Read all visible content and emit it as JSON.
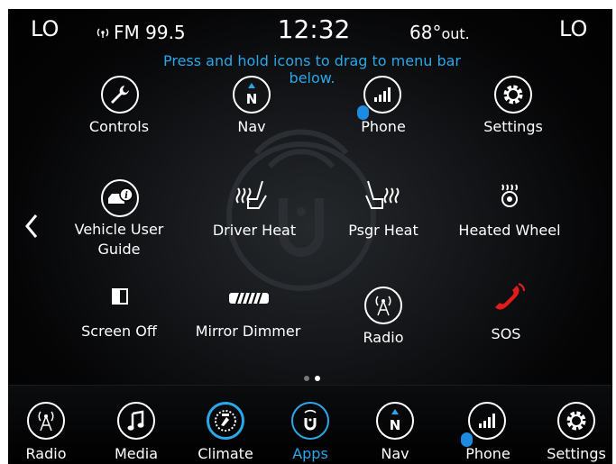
{
  "status": {
    "left_temp": "LO",
    "radio": "FM 99.5",
    "time": "12:32",
    "outside_temp": "68°",
    "outside_suffix": "out.",
    "right_temp": "LO"
  },
  "hint": "Press and hold icons to drag to menu bar below.",
  "apps": [
    {
      "label": "Controls",
      "icon": "wrench-icon"
    },
    {
      "label": "Nav",
      "icon": "compass-icon"
    },
    {
      "label": "Phone",
      "icon": "phone-signal-icon"
    },
    {
      "label": "Settings",
      "icon": "gear-icon"
    },
    {
      "label": "Vehicle User\nGuide",
      "icon": "vehicle-guide-icon"
    },
    {
      "label": "Driver Heat",
      "icon": "driver-seat-heat-icon"
    },
    {
      "label": "Psgr Heat",
      "icon": "passenger-seat-heat-icon"
    },
    {
      "label": "Heated Wheel",
      "icon": "heated-wheel-icon"
    },
    {
      "label": "Screen Off",
      "icon": "screen-off-icon"
    },
    {
      "label": "Mirror Dimmer",
      "icon": "mirror-dimmer-icon"
    },
    {
      "label": "Radio",
      "icon": "radio-antenna-icon"
    },
    {
      "label": "SOS",
      "icon": "sos-phone-icon"
    }
  ],
  "bottom_bar": [
    {
      "label": "Radio",
      "icon": "radio-antenna-icon"
    },
    {
      "label": "Media",
      "icon": "music-note-icon"
    },
    {
      "label": "Climate",
      "icon": "climate-icon"
    },
    {
      "label": "Apps",
      "icon": "apps-u-icon"
    },
    {
      "label": "Nav",
      "icon": "compass-icon"
    },
    {
      "label": "Phone",
      "icon": "phone-signal-icon"
    },
    {
      "label": "Settings",
      "icon": "gear-icon"
    }
  ],
  "colors": {
    "accent": "#2aa7e8",
    "sos": "#e21b1b",
    "background": "#000000"
  }
}
